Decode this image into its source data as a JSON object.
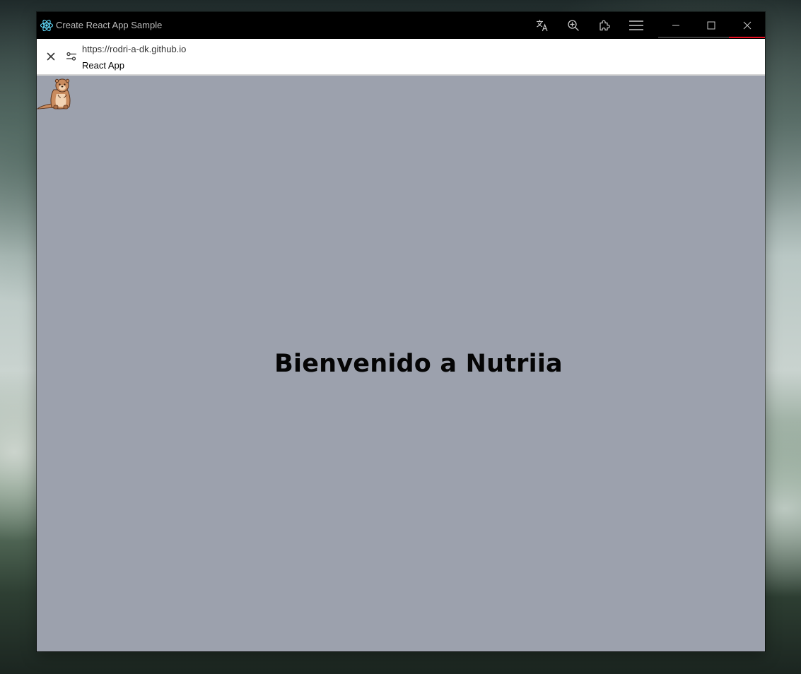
{
  "window": {
    "title": "Create React App Sample",
    "icons": {
      "app": "react-atom-icon",
      "translate": "translate-icon",
      "zoom": "zoom-in-icon",
      "extensions": "puzzle-piece-icon",
      "menu": "hamburger-menu-icon",
      "minimize": "minimize-icon",
      "maximize": "maximize-icon",
      "close": "close-icon"
    },
    "colors": {
      "titlebar": "#000000",
      "accent_react": "#61dafb",
      "accent_close": "#e81123"
    }
  },
  "address_bar": {
    "url": "https://rodri-a-dk.github.io",
    "page_title": "React App",
    "icons": {
      "close": "close-icon",
      "site_settings": "site-settings-sliders-icon"
    }
  },
  "page": {
    "heading": "Bienvenido a Nutriia",
    "logo_icon": "otter-icon",
    "background": "#9ca1ad"
  }
}
